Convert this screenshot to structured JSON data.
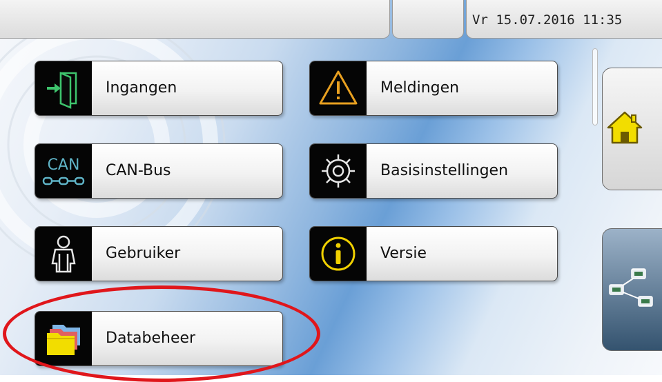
{
  "topbar": {
    "datetime": "Vr 15.07.2016 11:35"
  },
  "menu": {
    "items": [
      {
        "label": "Ingangen",
        "icon": "input-door-icon"
      },
      {
        "label": "Meldingen",
        "icon": "warning-icon"
      },
      {
        "label": "CAN-Bus",
        "icon": "can-bus-icon",
        "icon_text": "CAN"
      },
      {
        "label": "Basisinstellingen",
        "icon": "gear-icon"
      },
      {
        "label": "Gebruiker",
        "icon": "user-icon"
      },
      {
        "label": "Versie",
        "icon": "info-icon"
      },
      {
        "label": "Databeheer",
        "icon": "folder-icon"
      }
    ]
  },
  "sidebar": {
    "home_icon": "home-icon",
    "network_icon": "network-icon"
  },
  "colors": {
    "highlight": "#e0161b",
    "icon_bg": "#050505",
    "warning_accent": "#e8a020",
    "info_accent": "#f0d000",
    "can_accent": "#5fb3c6",
    "input_accent": "#3ec46d",
    "folder_accent": "#f2dd00"
  }
}
